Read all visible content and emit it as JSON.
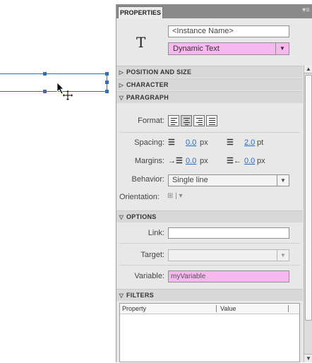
{
  "panel": {
    "tab_label": "PROPERTIES",
    "menu_icon": "panel-menu-icon",
    "instance_name_placeholder": "<Instance Name>",
    "text_type": "Dynamic Text",
    "tool_icon_glyph": "T"
  },
  "sections": {
    "position_size": "POSITION AND SIZE",
    "character": "CHARACTER",
    "paragraph": "PARAGRAPH",
    "options": "OPTIONS",
    "filters": "FILTERS"
  },
  "paragraph": {
    "format_label": "Format:",
    "spacing_label": "Spacing:",
    "spacing_indent_value": "0.0",
    "spacing_indent_unit": "px",
    "spacing_line_value": "2.0",
    "spacing_line_unit": "pt",
    "margins_label": "Margins:",
    "margin_left_value": "0.0",
    "margin_left_unit": "px",
    "margin_right_value": "0.0",
    "margin_right_unit": "px",
    "behavior_label": "Behavior:",
    "behavior_value": "Single line",
    "orientation_label": "Orientation:"
  },
  "options": {
    "link_label": "Link:",
    "link_value": "",
    "target_label": "Target:",
    "target_value": "",
    "variable_label": "Variable:",
    "variable_value": "myVariable"
  },
  "filters": {
    "col_property": "Property",
    "col_value": "Value"
  },
  "colors": {
    "accent_blue": "#2c6fc4",
    "highlight_pink": "#f7b8ef",
    "panel_bg": "#e8e8e8"
  }
}
